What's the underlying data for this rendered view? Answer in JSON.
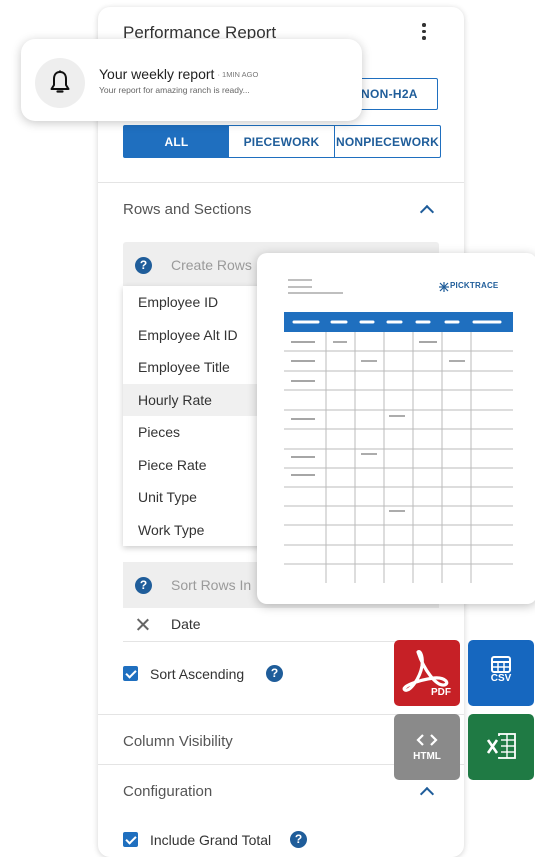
{
  "panel": {
    "title": "Performance Report",
    "visa_button": "NON-H2A",
    "tabs": [
      "ALL",
      "PIECEWORK",
      "NONPIECEWORK"
    ],
    "rows_section": "Rows and Sections",
    "create_rows_placeholder": "Create Rows",
    "row_options": [
      "Employee ID",
      "Employee Alt ID",
      "Employee Title",
      "Hourly Rate",
      "Pieces",
      "Piece Rate",
      "Unit Type",
      "Work Type"
    ],
    "sort_rows_placeholder": "Sort Rows In",
    "sort_value": "Date",
    "sort_ascending": "Sort Ascending",
    "column_visibility": "Column Visibility",
    "configuration": "Configuration",
    "include_grand_total": "Include Grand Total"
  },
  "notification": {
    "title": "Your weekly report",
    "time": "· 1MIN AGO",
    "body": "Your report for amazing ranch is ready..."
  },
  "preview": {
    "brand": "PICKTRACE"
  },
  "exports": {
    "pdf": "PDF",
    "csv": "CSV",
    "html": "HTML"
  },
  "colors": {
    "accent": "#1f6fbf",
    "pdf": "#c62026",
    "csv": "#1667bf",
    "html": "#8a8a8a",
    "excel": "#1f7a44"
  }
}
